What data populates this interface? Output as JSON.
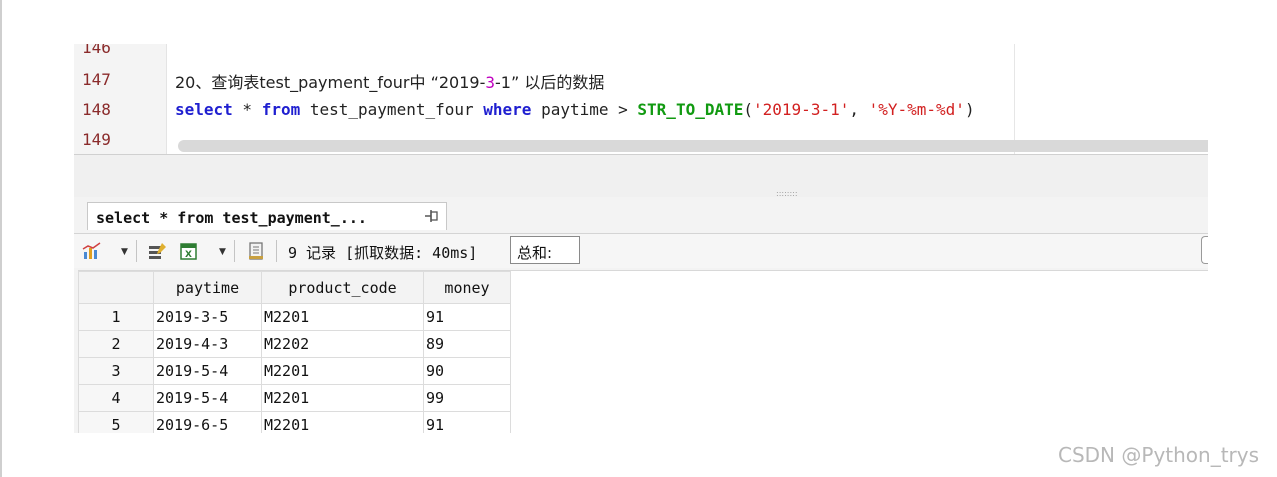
{
  "editor": {
    "lines": [
      {
        "number": "146"
      },
      {
        "number": "147"
      },
      {
        "number": "148"
      },
      {
        "number": "149"
      }
    ],
    "comment": {
      "prefix": "20、查询表test_payment_four中 “2019-",
      "highlight": "3",
      "suffix": "-1” 以后的数据"
    },
    "sql": {
      "kw_select": "select",
      "star": " * ",
      "kw_from": "from",
      "table": " test_payment_four ",
      "kw_where": "where",
      "condition": " paytime > ",
      "func": "STR_TO_DATE",
      "open": "(",
      "arg1": "'2019-3-1'",
      "comma": ", ",
      "arg2": "'%Y-%m-%d'",
      "close": ")"
    }
  },
  "results_tab": {
    "label": "select * from test_payment_..."
  },
  "toolbar": {
    "record_info": "9 记录 [抓取数据: 40ms]",
    "summary_label": "总和:"
  },
  "grid": {
    "columns": [
      "paytime",
      "product_code",
      "money"
    ],
    "rows": [
      {
        "n": "1",
        "paytime": "2019-3-5",
        "product_code": "M2201",
        "money": "91"
      },
      {
        "n": "2",
        "paytime": "2019-4-3",
        "product_code": "M2202",
        "money": "89"
      },
      {
        "n": "3",
        "paytime": "2019-5-4",
        "product_code": "M2201",
        "money": "90"
      },
      {
        "n": "4",
        "paytime": "2019-5-4",
        "product_code": "M2201",
        "money": "99"
      },
      {
        "n": "5",
        "paytime": "2019-6-5",
        "product_code": "M2201",
        "money": "91"
      }
    ]
  },
  "watermark": "CSDN @Python_trys",
  "colors": {
    "keyword": "#1f1fd0",
    "function": "#119a11",
    "string": "#d22020",
    "line_number": "#8a2a2a"
  }
}
